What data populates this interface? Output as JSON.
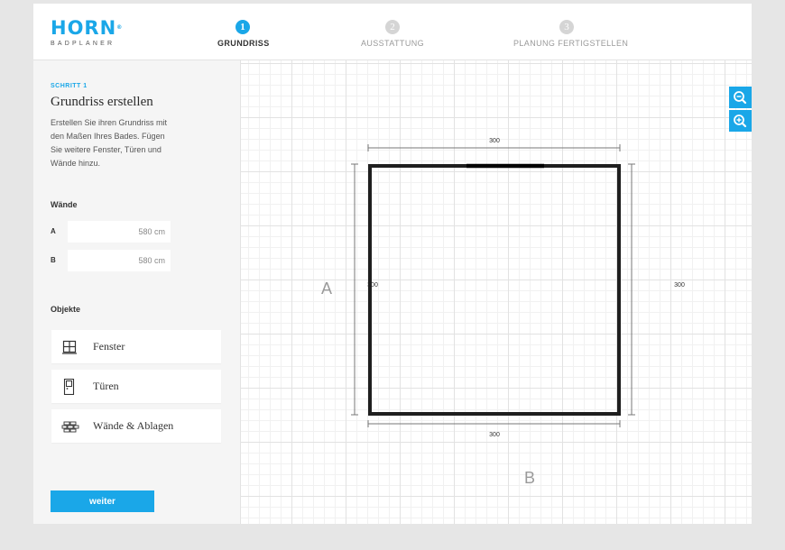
{
  "header": {
    "logo": {
      "brand": "HORN",
      "reg": "®",
      "sub": "BADPLANER"
    },
    "steps": [
      {
        "num": "1",
        "label": "GRUNDRISS",
        "active": true
      },
      {
        "num": "2",
        "label": "AUSSTATTUNG",
        "active": false
      },
      {
        "num": "3",
        "label": "PLANUNG FERTIGSTELLEN",
        "active": false
      }
    ]
  },
  "sidebar": {
    "kicker": "SCHRITT 1",
    "title": "Grundriss erstellen",
    "description": "Erstellen Sie ihren Grundriss mit den Maßen Ihres Bades. Fügen Sie weitere Fenster, Türen und Wände hinzu.",
    "walls_title": "Wände",
    "walls": [
      {
        "label": "A",
        "value": "580 cm"
      },
      {
        "label": "B",
        "value": "580 cm"
      }
    ],
    "objects_title": "Objekte",
    "objects": [
      {
        "label": "Fenster",
        "icon": "window-icon"
      },
      {
        "label": "Türen",
        "icon": "door-icon"
      },
      {
        "label": "Wände & Ablagen",
        "icon": "brick-wall-icon"
      }
    ],
    "next_label": "weiter"
  },
  "canvas": {
    "dimensions": {
      "top": "300",
      "bottom": "300",
      "left": "300",
      "right": "300"
    },
    "wall_labels": {
      "a": "A",
      "b": "B"
    },
    "zoom": {
      "in_icon": "zoom-in-icon",
      "out_icon": "zoom-out-icon"
    }
  },
  "colors": {
    "accent": "#1aa7e8",
    "wall": "#1f1f1f",
    "panel": "#f5f5f5",
    "outer": "#e6e6e6"
  }
}
